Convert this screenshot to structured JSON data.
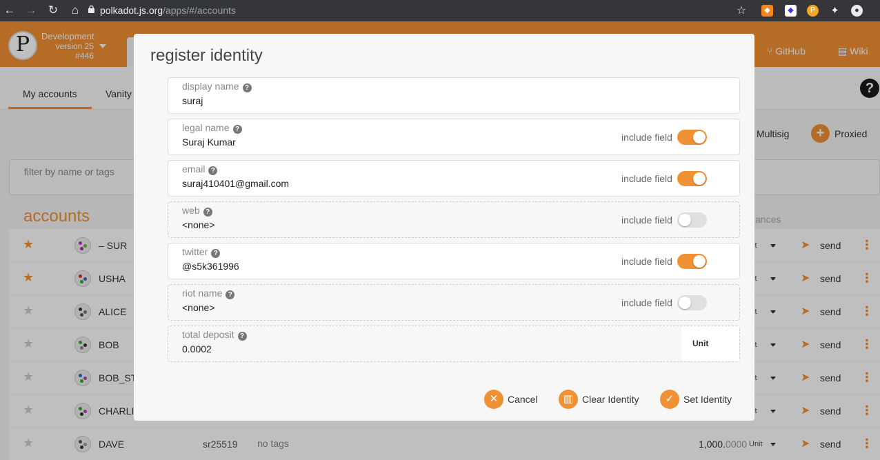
{
  "browser": {
    "url_host": "polkadot.js.org",
    "url_path": "/apps/#/accounts",
    "colors": {
      "chrome_bg": "#35363a",
      "accent": "#f19135"
    }
  },
  "app": {
    "chain_name": "Development",
    "version": "version 25",
    "build": "#446",
    "top_links": [
      "GitHub",
      "Wiki"
    ],
    "subtabs": [
      "My accounts",
      "Vanity"
    ],
    "filter_placeholder": "filter by name or tags",
    "accounts_heading": "accounts",
    "balances_heading": "ances",
    "multisig_label": "Multisig",
    "proxied_label": "Proxied",
    "rows": [
      {
        "name": "SUR",
        "starred": true,
        "prefix": "–"
      },
      {
        "name": "USHA",
        "starred": true
      },
      {
        "name": "ALICE",
        "starred": false
      },
      {
        "name": "BOB",
        "starred": false
      },
      {
        "name": "BOB_ST",
        "starred": false
      },
      {
        "name": "CHARLI",
        "starred": false
      },
      {
        "name": "DAVE",
        "starred": false,
        "type": "sr25519",
        "tags": "no tags",
        "balance_int": "1,000.",
        "balance_dec": "0000"
      }
    ],
    "unit": "Unit",
    "unit_short": "nit",
    "send_label": "send"
  },
  "modal": {
    "title": "register identity",
    "fields": [
      {
        "label": "display name",
        "value": "suraj",
        "has_toggle": false
      },
      {
        "label": "legal name",
        "value": "Suraj Kumar",
        "has_toggle": true,
        "include": true
      },
      {
        "label": "email",
        "value": "suraj410401@gmail.com",
        "has_toggle": true,
        "include": true
      },
      {
        "label": "web",
        "value": "<none>",
        "has_toggle": true,
        "include": false
      },
      {
        "label": "twitter",
        "value": "@s5k361996",
        "has_toggle": true,
        "include": true
      },
      {
        "label": "riot name",
        "value": "<none>",
        "has_toggle": true,
        "include": false
      },
      {
        "label": "total deposit",
        "value": "0.0002",
        "unit": "Unit"
      }
    ],
    "include_field_label": "include field",
    "buttons": {
      "cancel": "Cancel",
      "clear": "Clear Identity",
      "set": "Set Identity"
    }
  }
}
